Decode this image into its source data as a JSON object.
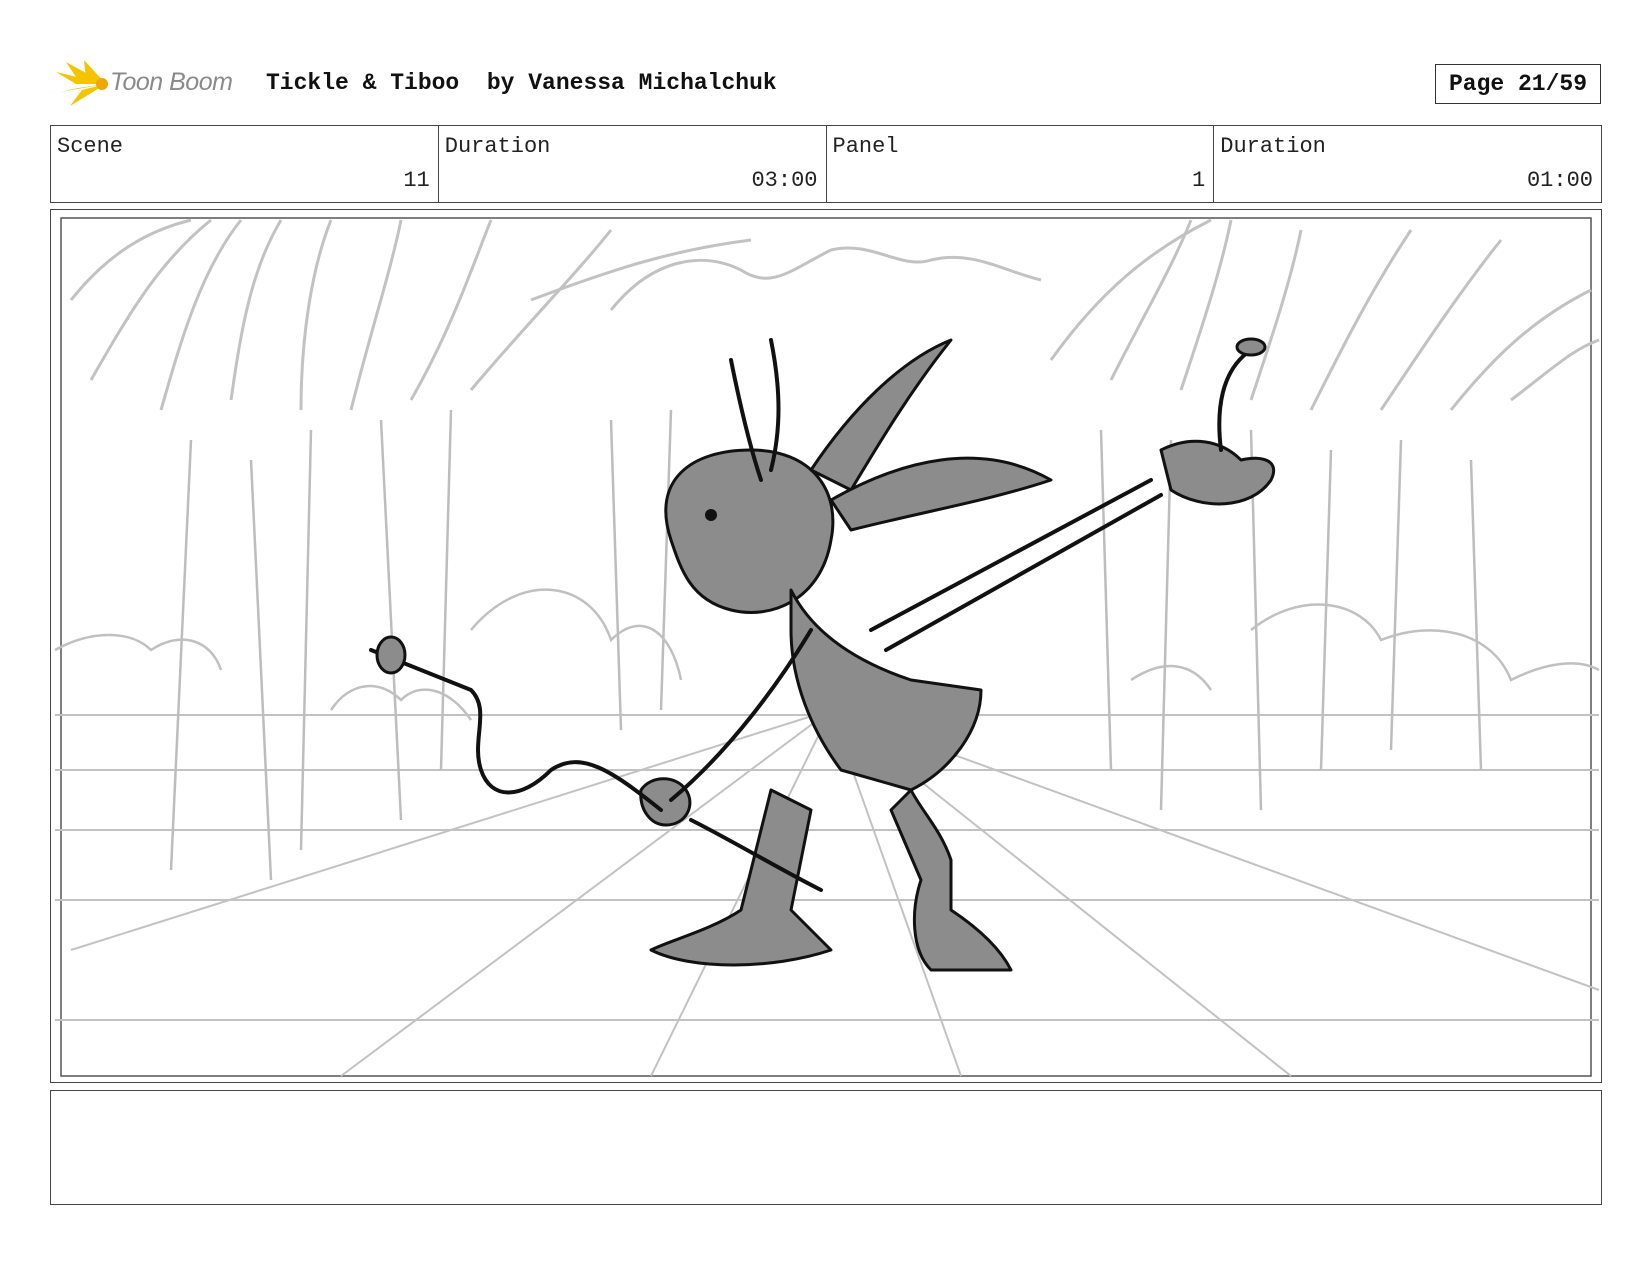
{
  "header": {
    "logo_text": "Toon Boom",
    "title": "Tickle & Tiboo  by Vanessa Michalchuk",
    "page": "Page 21/59"
  },
  "info": {
    "scene_label": "Scene",
    "scene_value": "11",
    "scene_duration_label": "Duration",
    "scene_duration_value": "03:00",
    "panel_label": "Panel",
    "panel_value": "1",
    "panel_duration_label": "Duration",
    "panel_duration_value": "01:00"
  },
  "notes": {
    "text": ""
  }
}
